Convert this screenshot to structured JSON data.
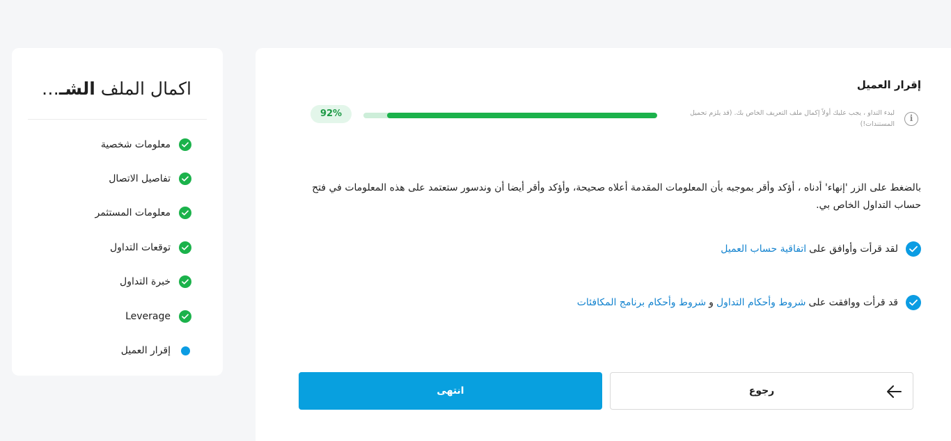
{
  "sidebar": {
    "title_prefix": "اكمال الملف ",
    "title_bold": "الشـ",
    "title_ellipsis": "…",
    "steps": [
      {
        "label": "معلومات شخصية",
        "status": "done"
      },
      {
        "label": "تفاصيل الاتصال",
        "status": "done"
      },
      {
        "label": "معلومات المستثمر",
        "status": "done"
      },
      {
        "label": "توقعات التداول",
        "status": "done"
      },
      {
        "label": "خبرة التداول",
        "status": "done"
      },
      {
        "label": "Leverage",
        "status": "done"
      },
      {
        "label": "إقرار العميل",
        "status": "current"
      }
    ]
  },
  "main": {
    "title": "إقرار العميل",
    "info_text": "لبدء التداو ، يجب عليك أولاً إكمال ملف التعريف الخاص بك. (قد يلزم تحميل المستندات!)",
    "progress": {
      "value": 92,
      "label": "92%"
    },
    "declaration": "بالضغط على الزر 'إنهاء' أدناه ، أؤكد وأقر بموجبه بأن المعلومات المقدمة أعلاه صحيحة، وأؤكد وأقر أيضا أن وندسور ستعتمد على هذه المعلومات في فتح حساب التداول الخاص بي.",
    "agreement1": {
      "text": "لقد قرأت وأوافق على",
      "link": "اتفاقية حساب العميل"
    },
    "agreement2": {
      "text": "قد قرأت ووافقت على",
      "link1": "شروط وأحكام التداول",
      "connector": "و",
      "link2": "شروط وأحكام برنامج المكافئات"
    },
    "back_label": "رجوع",
    "finish_label": "انتهى"
  },
  "colors": {
    "primary": "#08a0df",
    "success": "#1bb24b",
    "link": "#1383cf"
  }
}
